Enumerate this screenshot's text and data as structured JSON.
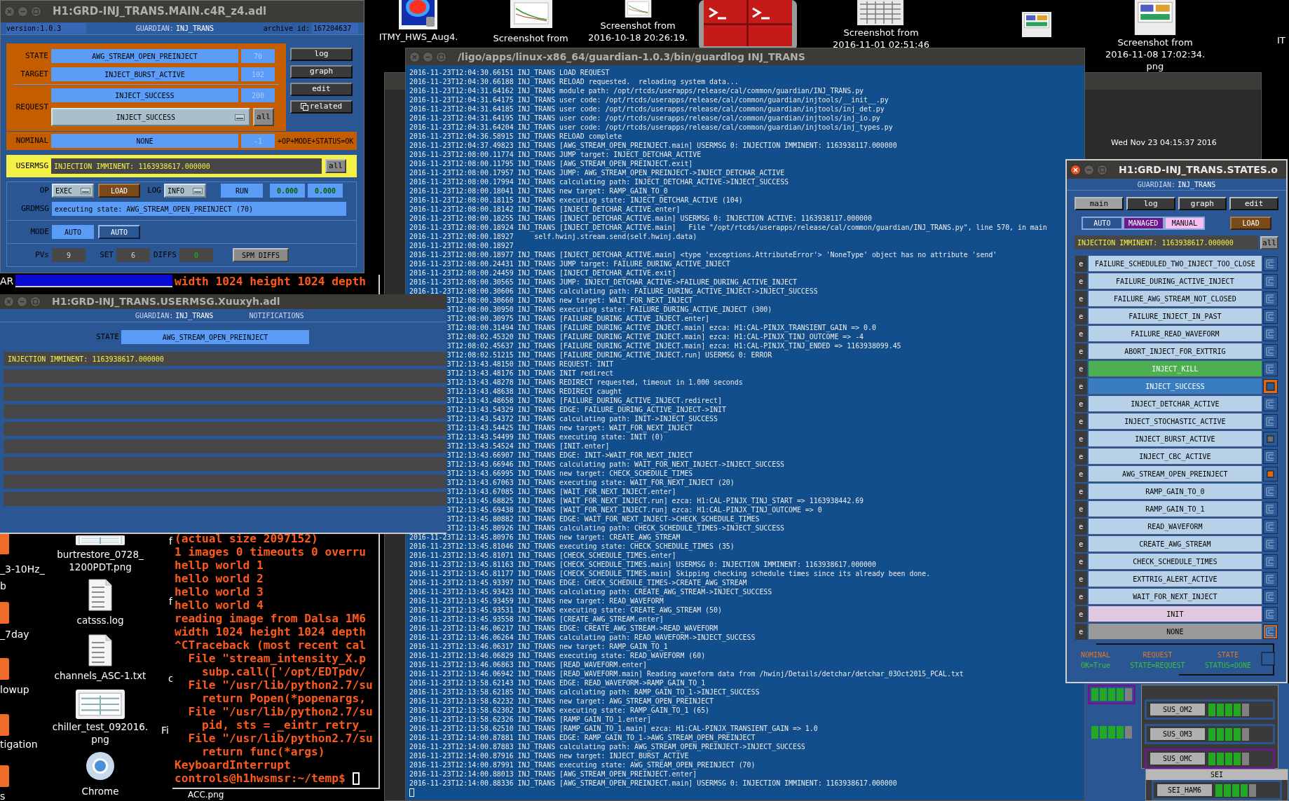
{
  "desktop": {
    "top_icons": [
      {
        "kind": "heatmap",
        "label": [
          "ITMY_HWS_Aug4."
        ]
      },
      {
        "kind": "chart",
        "label": [
          "Screenshot from"
        ]
      },
      {
        "kind": "chart",
        "label": [
          "Screenshot from",
          "2016-10-18 20:26:19."
        ]
      },
      {
        "kind": "terminal"
      },
      {
        "kind": "grid",
        "label": [
          "Screenshot from",
          "2016-11-01 02:51:46"
        ]
      },
      {
        "kind": "screen"
      },
      {
        "kind": "screen",
        "label": [
          "Screenshot from",
          "2016-11-08 17:02:34.",
          "png"
        ]
      }
    ],
    "edge_label": "IT",
    "window_label": "AR",
    "folders": [
      {
        "label": [
          "_3-10Hz_",
          "b"
        ]
      },
      {
        "label": [
          "_7day"
        ]
      },
      {
        "label": [
          "lowup"
        ]
      },
      {
        "label": [
          "tigation"
        ]
      },
      {
        "label": [
          "s"
        ]
      }
    ],
    "files": [
      {
        "kind": "image",
        "label": [
          "burtrestore_0728_",
          "1200PDT.png"
        ]
      },
      {
        "kind": "text",
        "label": [
          "catsss.log"
        ]
      },
      {
        "kind": "text",
        "label": [
          "channels_ASC-1.txt"
        ]
      },
      {
        "kind": "image",
        "label": [
          "chiller_test_092016.",
          "png"
        ]
      },
      {
        "kind": "browser",
        "label": [
          "Chrome"
        ]
      }
    ],
    "fragments": [
      "f",
      "f",
      "c",
      "Fi"
    ],
    "bottom_label": "ACC.png"
  },
  "background_window": {
    "clock": "Wed Nov 23 04:15:37 2016"
  },
  "main_window": {
    "title": "H1:GRD-INJ_TRANS.MAIN.c4R_z4.adl",
    "version": "version:1.0.3",
    "guardian_label": "GUARDIAN:",
    "guardian": "INJ_TRANS",
    "archive_label": "archive id:",
    "archive_id": "167204637",
    "state": {
      "label": "STATE",
      "value": "AWG_STREAM_OPEN_PREINJECT",
      "index": "70"
    },
    "target": {
      "label": "TARGET",
      "value": "INJECT_BURST_ACTIVE",
      "index": "102"
    },
    "request": {
      "label": "REQUEST",
      "value": "INJECT_SUCCESS",
      "index": "200",
      "menu_value": "INJECT_SUCCESS",
      "all": "all"
    },
    "nominal": {
      "label": "NOMINAL",
      "value": "NONE",
      "index": "-1",
      "status": "+OP+MODE+STATUS=OK"
    },
    "usermsg": {
      "label": "USERMSG",
      "value": "INJECTION IMMINENT: 1163938617.000000",
      "all": "all"
    },
    "side_buttons": [
      {
        "label": "log",
        "kind": "plain"
      },
      {
        "label": "graph",
        "kind": "plain"
      },
      {
        "label": "edit",
        "kind": "plain"
      },
      {
        "label": "related",
        "kind": "related"
      }
    ],
    "op": {
      "label": "OP",
      "value": "EXEC"
    },
    "load": "LOAD",
    "log": {
      "label": "LOG",
      "value": "INFO"
    },
    "run": "RUN",
    "readouts": [
      "0.000",
      "0.000"
    ],
    "grdmsg": {
      "label": "GRDMSG",
      "value": "executing state: AWG_STREAM_OPEN_PREINJECT (70)"
    },
    "mode": {
      "label": "MODE",
      "value": "AUTO",
      "button": "AUTO"
    },
    "pvs": {
      "label": "PVs",
      "value": "9"
    },
    "set": {
      "label": "SET",
      "value": "6"
    },
    "diffs": {
      "label": "DIFFS",
      "value": "0"
    },
    "spm_button": "SPM DIFFS"
  },
  "usermsg_window": {
    "title": "H1:GRD-INJ_TRANS.USERMSG.Xuuxyh.adl",
    "guardian_label": "GUARDIAN:",
    "guardian": "INJ_TRANS",
    "notifications": "NOTIFICATIONS",
    "state_label": "STATE",
    "state": "AWG_STREAM_OPEN_PREINJECT",
    "messages": [
      "INJECTION IMMINENT: 1163938617.000000"
    ]
  },
  "terminal": {
    "top_lines": [
      "width 1024 height 1024 depth"
    ],
    "lines": [
      "(actual size 2097152)",
      "1 images 0 timeouts 0 overru",
      "hellp world 1",
      "hello world 2",
      "hello world 3",
      "hello world 4",
      "reading image from Dalsa 1M6",
      "width 1024 height 1024 depth",
      "^CTraceback (most recent cal",
      "  File \"stream_intensity_X.p",
      "    subp.call(['/opt/EDTpdv/",
      "  File \"/usr/lib/python2.7/su",
      "    return Popen(*popenargs,",
      "  File \"/usr/lib/python2.7/su",
      "    pid, sts = _eintr_retry_",
      "  File \"/usr/lib/python2.7/su",
      "    return func(*args)",
      "KeyboardInterrupt",
      "controls@h1hwsmsr:~/temp$"
    ]
  },
  "log_window": {
    "title": "/ligo/apps/linux-x86_64/guardian-1.0.3/bin/guardlog INJ_TRANS",
    "lines": [
      {
        "text": "2016-11-23T12:04:30.66151 INJ_TRANS LOAD REQUEST",
        "covered": false
      },
      {
        "text": "2016-11-23T12:04:30.66188 INJ_TRANS RELOAD requested.  reloading system data...",
        "covered": false
      },
      {
        "text": "2016-11-23T12:04:31.64162 INJ_TRANS module path: /opt/rtcds/userapps/release/cal/common/guardian/INJ_TRANS.py",
        "covered": false
      },
      {
        "text": "2016-11-23T12:04:31.64175 INJ_TRANS user code: /opt/rtcds/userapps/release/cal/common/guardian/injtools/__init__.py",
        "covered": false
      },
      {
        "text": "2016-11-23T12:04:31.64185 INJ_TRANS user code: /opt/rtcds/userapps/release/cal/common/guardian/injtools/inj_det.py",
        "covered": false
      },
      {
        "text": "2016-11-23T12:04:31.64195 INJ_TRANS user code: /opt/rtcds/userapps/release/cal/common/guardian/injtools/inj_io.py",
        "covered": false
      },
      {
        "text": "2016-11-23T12:04:31.64204 INJ_TRANS user code: /opt/rtcds/userapps/release/cal/common/guardian/injtools/inj_types.py",
        "covered": false
      },
      {
        "text": "2016-11-23T12:04:36.58915 INJ_TRANS RELOAD complete",
        "covered": false
      },
      {
        "text": "2016-11-23T12:04:37.49823 INJ_TRANS [AWG_STREAM_OPEN_PREINJECT.main] USERMSG 0: INJECTION IMMINENT: 1163938117.000000",
        "covered": false
      },
      {
        "text": "2016-11-23T12:08:00.11774 INJ_TRANS JUMP target: INJECT_DETCHAR_ACTIVE",
        "covered": false
      },
      {
        "text": "2016-11-23T12:08:00.11795 INJ_TRANS [AWG_STREAM_OPEN_PREINJECT.exit]",
        "covered": false
      },
      {
        "text": "2016-11-23T12:08:00.17957 INJ_TRANS JUMP: AWG_STREAM_OPEN_PREINJECT->INJECT_DETCHAR_ACTIVE",
        "covered": false
      },
      {
        "text": "2016-11-23T12:08:00.17994 INJ_TRANS calculating path: INJECT_DETCHAR_ACTIVE->INJECT_SUCCESS",
        "covered": false
      },
      {
        "text": "2016-11-23T12:08:00.18041 INJ_TRANS new target: RAMP_GAIN_TO_0",
        "covered": false
      },
      {
        "text": "2016-11-23T12:08:00.18115 INJ_TRANS executing state: INJECT_DETCHAR_ACTIVE (104)",
        "covered": false
      },
      {
        "text": "2016-11-23T12:08:00.18142 INJ_TRANS [INJECT_DETCHAR_ACTIVE.enter]",
        "covered": false
      },
      {
        "text": "2016-11-23T12:08:00.18255 INJ_TRANS [INJECT_DETCHAR_ACTIVE.main] USERMSG 0: INJECTION ACTIVE: 1163938117.000000",
        "covered": false
      },
      {
        "text": "2016-11-23T12:08:00.18924 INJ_TRANS [INJECT_DETCHAR_ACTIVE.main]   File \"/opt/rtcds/userapps/release/cal/common/guardian/INJ_TRANS.py\", line 570, in main",
        "covered": false
      },
      {
        "text": "2016-11-23T12:08:00.18927     self.hwinj.stream.send(self.hwinj.data)",
        "covered": false
      },
      {
        "text": "2016-11-23T12:08:00.18927",
        "covered": false
      },
      {
        "text": "2016-11-23T12:08:00.18977 INJ_TRANS [INJECT_DETCHAR_ACTIVE.main] <type 'exceptions.AttributeError'> 'NoneType' object has no attribute 'send'",
        "covered": false
      },
      {
        "text": "2016-11-23T12:08:00.24431 INJ_TRANS JUMP target: FAILURE_DURING_ACTIVE_INJECT",
        "covered": false
      },
      {
        "text": "2016-11-23T12:08:00.24459 INJ_TRANS [INJECT_DETCHAR_ACTIVE.exit]",
        "covered": false
      },
      {
        "text": "2016-11-23T12:08:00.30565 INJ_TRANS JUMP: INJECT_DETCHAR_ACTIVE->FAILURE_DURING_ACTIVE_INJECT",
        "covered": false
      },
      {
        "text": "2016-11-23T12:08:00.30606 INJ_TRANS calculating path: FAILURE_DURING_ACTIVE_INJECT->INJECT_SUCCESS",
        "covered": false
      },
      {
        "text": "3T12:08:00.30660 INJ_TRANS new target: WAIT_FOR_NEXT_INJECT",
        "covered": true
      },
      {
        "text": "3T12:08:00.30950 INJ_TRANS executing state: FAILURE_DURING_ACTIVE_INJECT (300)",
        "covered": true
      },
      {
        "text": "3T12:08:00.30975 INJ_TRANS [FAILURE_DURING_ACTIVE_INJECT.enter]",
        "covered": true
      },
      {
        "text": "3T12:08:00.31494 INJ_TRANS [FAILURE_DURING_ACTIVE_INJECT.main] ezca: H1:CAL-PINJX_TRANSIENT_GAIN => 0.0",
        "covered": true
      },
      {
        "text": "3T12:08:02.45320 INJ_TRANS [FAILURE_DURING_ACTIVE_INJECT.main] ezca: H1:CAL-PINJX_TINJ_OUTCOME => -4",
        "covered": true
      },
      {
        "text": "3T12:08:02.45637 INJ_TRANS [FAILURE_DURING_ACTIVE_INJECT.main] ezca: H1:CAL-PINJX_TINJ_ENDED => 1163938099.45",
        "covered": true
      },
      {
        "text": "3T12:08:02.51215 INJ_TRANS [FAILURE_DURING_ACTIVE_INJECT.run] USERMSG 0: ERROR",
        "covered": true
      },
      {
        "text": "3T12:13:43.48150 INJ_TRANS REQUEST: INIT",
        "covered": true
      },
      {
        "text": "3T12:13:43.48176 INJ_TRANS INIT redirect",
        "covered": true
      },
      {
        "text": "3T12:13:43.48278 INJ_TRANS REDIRECT requested, timeout in 1.000 seconds",
        "covered": true
      },
      {
        "text": "3T12:13:43.48638 INJ_TRANS REDIRECT caught",
        "covered": true
      },
      {
        "text": "3T12:13:43.48658 INJ_TRANS [FAILURE_DURING_ACTIVE_INJECT.redirect]",
        "covered": true
      },
      {
        "text": "3T12:13:43.54329 INJ_TRANS EDGE: FAILURE_DURING_ACTIVE_INJECT->INIT",
        "covered": true
      },
      {
        "text": "3T12:13:43.54372 INJ_TRANS calculating path: INIT->INJECT_SUCCESS",
        "covered": true
      },
      {
        "text": "3T12:13:43.54425 INJ_TRANS new target: WAIT_FOR_NEXT_INJECT",
        "covered": true
      },
      {
        "text": "3T12:13:43.54499 INJ_TRANS executing state: INIT (0)",
        "covered": true
      },
      {
        "text": "3T12:13:43.54524 INJ_TRANS [INIT.enter]",
        "covered": true
      },
      {
        "text": "3T12:13:43.66907 INJ_TRANS EDGE: INIT->WAIT_FOR_NEXT_INJECT",
        "covered": true
      },
      {
        "text": "3T12:13:43.66946 INJ_TRANS calculating path: WAIT_FOR_NEXT_INJECT->INJECT_SUCCESS",
        "covered": true
      },
      {
        "text": "3T12:13:43.66995 INJ_TRANS new target: CHECK_SCHEDULE_TIMES",
        "covered": true
      },
      {
        "text": "3T12:13:43.67063 INJ_TRANS executing state: WAIT_FOR_NEXT_INJECT (20)",
        "covered": true
      },
      {
        "text": "3T12:13:43.67085 INJ_TRANS [WAIT_FOR_NEXT_INJECT.enter]",
        "covered": true
      },
      {
        "text": "3T12:13:45.68825 INJ_TRANS [WAIT_FOR_NEXT_INJECT.run] ezca: H1:CAL-PINJX_TINJ_START => 1163938442.69",
        "covered": true
      },
      {
        "text": "3T12:13:45.69438 INJ_TRANS [WAIT_FOR_NEXT_INJECT.run] ezca: H1:CAL-PINJX_TINJ_OUTCOME => 0",
        "covered": true
      },
      {
        "text": "3T12:13:45.80882 INJ_TRANS EDGE: WAIT_FOR_NEXT_INJECT->CHECK_SCHEDULE_TIMES",
        "covered": true
      },
      {
        "text": "3T12:13:45.80926 INJ_TRANS calculating path: CHECK_SCHEDULE_TIMES->INJECT_SUCCESS",
        "covered": true
      },
      {
        "text": "2016-11-23T12:13:45.80976 INJ_TRANS new target: CREATE_AWG_STREAM",
        "covered": false
      },
      {
        "text": "2016-11-23T12:13:45.81046 INJ_TRANS executing state: CHECK_SCHEDULE_TIMES (35)",
        "covered": false
      },
      {
        "text": "2016-11-23T12:13:45.81071 INJ_TRANS [CHECK_SCHEDULE_TIMES.enter]",
        "covered": false
      },
      {
        "text": "2016-11-23T12:13:45.81163 INJ_TRANS [CHECK_SCHEDULE_TIMES.main] USERMSG 0: INJECTION IMMINENT: 1163938617.000000",
        "covered": false
      },
      {
        "text": "2016-11-23T12:13:45.81177 INJ_TRANS [CHECK_SCHEDULE_TIMES.main] Skipping checking schedule times since its already been done.",
        "covered": false
      },
      {
        "text": "2016-11-23T12:13:45.93397 INJ_TRANS EDGE: CHECK_SCHEDULE_TIMES->CREATE_AWG_STREAM",
        "covered": false
      },
      {
        "text": "2016-11-23T12:13:45.93423 INJ_TRANS calculating path: CREATE_AWG_STREAM->INJECT_SUCCESS",
        "covered": false
      },
      {
        "text": "2016-11-23T12:13:45.93459 INJ_TRANS new target: READ_WAVEFORM",
        "covered": false
      },
      {
        "text": "2016-11-23T12:13:45.93531 INJ_TRANS executing state: CREATE_AWG_STREAM (50)",
        "covered": false
      },
      {
        "text": "2016-11-23T12:13:45.93558 INJ_TRANS [CREATE_AWG_STREAM.enter]",
        "covered": false
      },
      {
        "text": "2016-11-23T12:13:46.06217 INJ_TRANS EDGE: CREATE_AWG_STREAM->READ_WAVEFORM",
        "covered": false
      },
      {
        "text": "2016-11-23T12:13:46.06264 INJ_TRANS calculating path: READ_WAVEFORM->INJECT_SUCCESS",
        "covered": false
      },
      {
        "text": "2016-11-23T12:13:46.06317 INJ_TRANS new target: RAMP_GAIN_TO_1",
        "covered": false
      },
      {
        "text": "2016-11-23T12:13:46.06829 INJ_TRANS executing state: READ_WAVEFORM (60)",
        "covered": false
      },
      {
        "text": "2016-11-23T12:13:46.06863 INJ_TRANS [READ_WAVEFORM.enter]",
        "covered": false
      },
      {
        "text": "2016-11-23T12:13:46.06942 INJ_TRANS [READ_WAVEFORM.main] Reading waveform data from /hwinj/Details/detchar/detchar_03Oct2015_PCAL.txt",
        "covered": false
      },
      {
        "text": "2016-11-23T12:13:58.62143 INJ_TRANS EDGE: READ_WAVEFORM->RAMP_GAIN_TO_1",
        "covered": false
      },
      {
        "text": "2016-11-23T12:13:58.62185 INJ_TRANS calculating path: RAMP_GAIN_TO_1->INJECT_SUCCESS",
        "covered": false
      },
      {
        "text": "2016-11-23T12:13:58.62232 INJ_TRANS new target: AWG_STREAM_OPEN_PREINJECT",
        "covered": false
      },
      {
        "text": "2016-11-23T12:13:58.62302 INJ_TRANS executing state: RAMP_GAIN_TO_1 (65)",
        "covered": false
      },
      {
        "text": "2016-11-23T12:13:58.62326 INJ_TRANS [RAMP_GAIN_TO_1.enter]",
        "covered": false
      },
      {
        "text": "2016-11-23T12:13:58.62510 INJ_TRANS [RAMP_GAIN_TO_1.main] ezca: H1:CAL-PINJX_TRANSIENT_GAIN => 1.0",
        "covered": false
      },
      {
        "text": "2016-11-23T12:14:00.87881 INJ_TRANS EDGE: RAMP_GAIN_TO_1->AWG_STREAM_OPEN_PREINJECT",
        "covered": false
      },
      {
        "text": "2016-11-23T12:14:00.87883 INJ_TRANS calculating path: AWG_STREAM_OPEN_PREINJECT->INJECT_SUCCESS",
        "covered": false
      },
      {
        "text": "2016-11-23T12:14:00.87916 INJ_TRANS new target: INJECT_BURST_ACTIVE",
        "covered": false
      },
      {
        "text": "2016-11-23T12:14:00.87991 INJ_TRANS executing state: AWG_STREAM_OPEN_PREINJECT (70)",
        "covered": false
      },
      {
        "text": "2016-11-23T12:14:00.88013 INJ_TRANS [AWG_STREAM_OPEN_PREINJECT.enter]",
        "covered": false
      },
      {
        "text": "2016-11-23T12:14:00.88336 INJ_TRANS [AWG_STREAM_OPEN_PREINJECT.main] USERMSG 0: INJECTION IMMINENT: 1163938617.000000",
        "covered": false
      }
    ]
  },
  "states_window": {
    "title": "H1:GRD-INJ_TRANS.STATES.o",
    "focused": true,
    "guardian_label": "GUARDIAN:",
    "guardian": "INJ_TRANS",
    "nav_buttons": [
      {
        "label": "main",
        "selected": true
      },
      {
        "label": "log",
        "selected": false
      },
      {
        "label": "graph",
        "selected": false
      },
      {
        "label": "edit",
        "selected": false
      }
    ],
    "modes": [
      {
        "label": "AUTO",
        "color": "#2a5590"
      },
      {
        "label": "MANAGED",
        "color": "#6a1a8a"
      },
      {
        "label": "MANUAL",
        "color": "#f7bdf5"
      }
    ],
    "load": "LOAD",
    "usermsg": "INJECTION IMMINENT: 1163938617.000000",
    "all": "all",
    "states": [
      {
        "edit": "e",
        "name": "FAILURE_SCHEDULED_TWO_INJECT_TOO_CLOSE",
        "color": "#b7d2e8",
        "request": false,
        "nominal": false,
        "current": false,
        "target": false
      },
      {
        "edit": "e",
        "name": "FAILURE_DURING_ACTIVE_INJECT",
        "color": "#b7d2e8",
        "request": false,
        "nominal": false,
        "current": false,
        "target": false
      },
      {
        "edit": "e",
        "name": "FAILURE_AWG_STREAM_NOT_CLOSED",
        "color": "#b7d2e8",
        "request": false,
        "nominal": false,
        "current": false,
        "target": false
      },
      {
        "edit": "e",
        "name": "FAILURE_INJECT_IN_PAST",
        "color": "#b7d2e8",
        "request": false,
        "nominal": false,
        "current": false,
        "target": false
      },
      {
        "edit": "e",
        "name": "FAILURE_READ_WAVEFORM",
        "color": "#b7d2e8",
        "request": false,
        "nominal": false,
        "current": false,
        "target": false
      },
      {
        "edit": "e",
        "name": "ABORT_INJECT_FOR_EXTTRIG",
        "color": "#b7d2e8",
        "request": false,
        "nominal": false,
        "current": false,
        "target": false
      },
      {
        "edit": "e",
        "name": "INJECT_KILL",
        "color": "#4caf50",
        "request": false,
        "nominal": false,
        "current": false,
        "target": false
      },
      {
        "edit": "e",
        "name": "INJECT_SUCCESS",
        "color": "#3a7cc0",
        "request": true,
        "nominal": false,
        "current": false,
        "target": false
      },
      {
        "edit": "e",
        "name": "INJECT_DETCHAR_ACTIVE",
        "color": "#b7d2e8",
        "request": false,
        "nominal": false,
        "current": false,
        "target": false
      },
      {
        "edit": "e",
        "name": "INJECT_STOCHASTIC_ACTIVE",
        "color": "#b7d2e8",
        "request": false,
        "nominal": false,
        "current": false,
        "target": false
      },
      {
        "edit": "e",
        "name": "INJECT_BURST_ACTIVE",
        "color": "#b7d2e8",
        "request": false,
        "nominal": false,
        "current": false,
        "target": true
      },
      {
        "edit": "e",
        "name": "INJECT_CBC_ACTIVE",
        "color": "#b7d2e8",
        "request": false,
        "nominal": false,
        "current": false,
        "target": false
      },
      {
        "edit": "e",
        "name": "AWG_STREAM_OPEN_PREINJECT",
        "color": "#b7d2e8",
        "request": false,
        "nominal": false,
        "current": true,
        "target": false
      },
      {
        "edit": "e",
        "name": "RAMP_GAIN_TO_0",
        "color": "#b7d2e8",
        "request": false,
        "nominal": false,
        "current": false,
        "target": false
      },
      {
        "edit": "e",
        "name": "RAMP_GAIN_TO_1",
        "color": "#b7d2e8",
        "request": false,
        "nominal": false,
        "current": false,
        "target": false
      },
      {
        "edit": "e",
        "name": "READ_WAVEFORM",
        "color": "#b7d2e8",
        "request": false,
        "nominal": false,
        "current": false,
        "target": false
      },
      {
        "edit": "e",
        "name": "CREATE_AWG_STREAM",
        "color": "#b7d2e8",
        "request": false,
        "nominal": false,
        "current": false,
        "target": false
      },
      {
        "edit": "e",
        "name": "CHECK_SCHEDULE_TIMES",
        "color": "#b7d2e8",
        "request": false,
        "nominal": false,
        "current": false,
        "target": false
      },
      {
        "edit": "e",
        "name": "EXTTRIG_ALERT_ACTIVE",
        "color": "#b7d2e8",
        "request": false,
        "nominal": false,
        "current": false,
        "target": false
      },
      {
        "edit": "e",
        "name": "WAIT_FOR_NEXT_INJECT",
        "color": "#b7d2e8",
        "request": false,
        "nominal": false,
        "current": false,
        "target": false
      },
      {
        "edit": "e",
        "name": "INIT",
        "color": "#e0c8e0",
        "request": false,
        "nominal": false,
        "current": false,
        "target": false
      },
      {
        "edit": "e",
        "name": "NONE",
        "color": "#9a9a9a",
        "request": false,
        "nominal": true,
        "current": false,
        "target": false
      }
    ],
    "legend": [
      {
        "label": "NOMINAL",
        "value": "OK=True"
      },
      {
        "label": "REQUEST",
        "value": "STATE=REQUEST"
      },
      {
        "label": "STATE",
        "value": "STATUS=DONE"
      }
    ]
  },
  "sus_panel": {
    "side_meters": [
      {
        "color": "#6a1a8a",
        "segments": [
          true,
          true,
          true,
          true,
          false
        ]
      },
      {
        "color": "#2a5590",
        "segments": [
          true,
          true,
          true,
          true,
          false
        ]
      }
    ],
    "items": [
      {
        "label": "SUS_OM2",
        "color": "#2a5590",
        "segments": [
          true,
          true,
          true,
          true,
          false
        ]
      },
      {
        "label": "SUS_OM3",
        "color": "#2a5590",
        "segments": [
          true,
          true,
          true,
          true,
          false
        ]
      },
      {
        "label": "SUS_OMC",
        "color": "#6a1a8a",
        "segments": [
          true,
          true,
          true,
          true,
          false
        ]
      }
    ],
    "sei_heading": "SEI",
    "sei_items": [
      {
        "label": "SEI_HAM6",
        "color": "#2a5590",
        "segments": [
          true,
          true,
          true,
          true,
          false
        ]
      }
    ]
  }
}
